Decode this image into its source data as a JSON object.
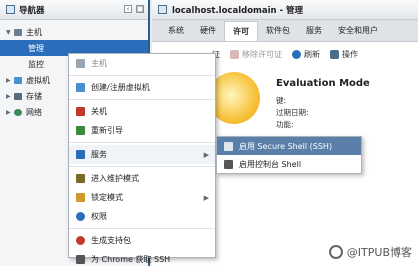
{
  "navigator": {
    "title": "导航器",
    "tree": [
      {
        "label": "主机",
        "expanded": true
      },
      {
        "label": "管理",
        "selected": true
      },
      {
        "label": "监控"
      },
      {
        "label": "虚拟机"
      },
      {
        "label": "存储"
      },
      {
        "label": "网络"
      }
    ]
  },
  "main": {
    "title": "localhost.localdomain - 管理",
    "tabs": [
      "系统",
      "硬件",
      "许可",
      "软件包",
      "服务",
      "安全和用户"
    ],
    "active_tab": "许可",
    "toolbar": {
      "assign_label": "证",
      "remove_label": "移除许可证",
      "refresh_label": "刷新",
      "actions_label": "操作"
    },
    "license": {
      "title": "Evaluation Mode",
      "key_label": "键:",
      "expiry_label": "过期日期:",
      "features_label": "功能:"
    }
  },
  "context_menu": {
    "header": "主机",
    "items": [
      {
        "label": "创建/注册虚拟机",
        "icon": "create-vm-icon",
        "color": "#4a8fd0"
      },
      {
        "label": "关机",
        "icon": "shutdown-icon",
        "color": "#c0392b"
      },
      {
        "label": "重新引导",
        "icon": "reboot-icon",
        "color": "#3a8a3a"
      },
      {
        "label": "服务",
        "icon": "services-icon",
        "color": "#2a6ebb",
        "submenu": true
      },
      {
        "label": "进入维护模式",
        "icon": "maintenance-icon",
        "color": "#7a6a2a"
      },
      {
        "label": "锁定模式",
        "icon": "lockdown-icon",
        "color": "#d09a2a",
        "submenu": true
      },
      {
        "label": "权限",
        "icon": "permissions-icon",
        "color": "#2a6ebb"
      },
      {
        "label": "生成支持包",
        "icon": "support-bundle-icon",
        "color": "#c0392b"
      },
      {
        "label": "为 Chrome 获取 SSH",
        "icon": "ssh-chrome-icon",
        "color": "#555"
      }
    ]
  },
  "submenu": {
    "items": [
      {
        "label": "启用 Secure Shell (SSH)",
        "active": true
      },
      {
        "label": "启用控制台 Shell",
        "active": false
      }
    ]
  },
  "watermark": "@ITPUB博客"
}
